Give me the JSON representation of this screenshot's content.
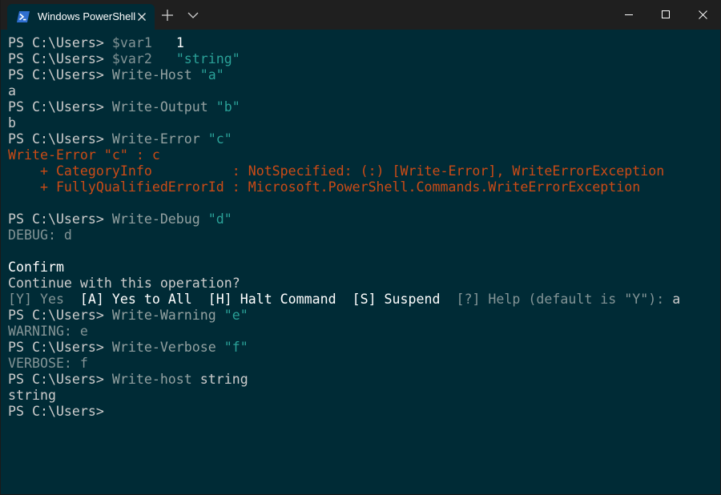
{
  "window": {
    "tab_title": "Windows PowerShell"
  },
  "terminal": {
    "lines": [
      [
        {
          "t": "PS C:\\Users> ",
          "c": "prompt"
        },
        {
          "t": "$var1",
          "c": "var"
        },
        {
          "t": "   ",
          "c": "out"
        },
        {
          "t": "1",
          "c": "num"
        }
      ],
      [
        {
          "t": "PS C:\\Users> ",
          "c": "prompt"
        },
        {
          "t": "$var2",
          "c": "var"
        },
        {
          "t": "   ",
          "c": "out"
        },
        {
          "t": "\"string\"",
          "c": "str"
        }
      ],
      [
        {
          "t": "PS C:\\Users> ",
          "c": "prompt"
        },
        {
          "t": "Write-Host",
          "c": "cmd"
        },
        {
          "t": " ",
          "c": "out"
        },
        {
          "t": "\"a\"",
          "c": "str"
        }
      ],
      [
        {
          "t": "a",
          "c": "out"
        }
      ],
      [
        {
          "t": "PS C:\\Users> ",
          "c": "prompt"
        },
        {
          "t": "Write-Output",
          "c": "cmd"
        },
        {
          "t": " ",
          "c": "out"
        },
        {
          "t": "\"b\"",
          "c": "str"
        }
      ],
      [
        {
          "t": "b",
          "c": "out"
        }
      ],
      [
        {
          "t": "PS C:\\Users> ",
          "c": "prompt"
        },
        {
          "t": "Write-Error",
          "c": "cmd"
        },
        {
          "t": " ",
          "c": "out"
        },
        {
          "t": "\"c\"",
          "c": "str"
        }
      ],
      [
        {
          "t": "Write-Error \"c\" : c",
          "c": "err"
        }
      ],
      [
        {
          "t": "    + CategoryInfo          : NotSpecified: (:) [Write-Error], WriteErrorException",
          "c": "err"
        }
      ],
      [
        {
          "t": "    + FullyQualifiedErrorId : Microsoft.PowerShell.Commands.WriteErrorException",
          "c": "err"
        }
      ],
      [],
      [
        {
          "t": "PS C:\\Users> ",
          "c": "prompt"
        },
        {
          "t": "Write-Debug",
          "c": "cmd"
        },
        {
          "t": " ",
          "c": "out"
        },
        {
          "t": "\"d\"",
          "c": "str"
        }
      ],
      [
        {
          "t": "DEBUG: d",
          "c": "dim"
        }
      ],
      [],
      [
        {
          "t": "Confirm",
          "c": "white"
        }
      ],
      [
        {
          "t": "Continue with this operation?",
          "c": "out"
        }
      ],
      [
        {
          "t": "[Y] Yes  ",
          "c": "dim"
        },
        {
          "t": "[A] Yes to All  [H] Halt Command  [S] Suspend  ",
          "c": "white"
        },
        {
          "t": "[?] Help (default is \"Y\"): ",
          "c": "dim"
        },
        {
          "t": "a",
          "c": "out"
        }
      ],
      [
        {
          "t": "PS C:\\Users> ",
          "c": "prompt"
        },
        {
          "t": "Write-Warning",
          "c": "cmd"
        },
        {
          "t": " ",
          "c": "out"
        },
        {
          "t": "\"e\"",
          "c": "str"
        }
      ],
      [
        {
          "t": "WARNING: e",
          "c": "dim"
        }
      ],
      [
        {
          "t": "PS C:\\Users> ",
          "c": "prompt"
        },
        {
          "t": "Write-Verbose",
          "c": "cmd"
        },
        {
          "t": " ",
          "c": "out"
        },
        {
          "t": "\"f\"",
          "c": "str"
        }
      ],
      [
        {
          "t": "VERBOSE: f",
          "c": "dim"
        }
      ],
      [
        {
          "t": "PS C:\\Users> ",
          "c": "prompt"
        },
        {
          "t": "Write-host",
          "c": "cmd"
        },
        {
          "t": " string",
          "c": "out"
        }
      ],
      [
        {
          "t": "string",
          "c": "out"
        }
      ],
      [
        {
          "t": "PS C:\\Users>",
          "c": "prompt"
        }
      ]
    ]
  },
  "icons": {
    "tab": "powershell-icon",
    "tab_close": "close-icon",
    "new_tab": "plus-icon",
    "dropdown": "chevron-down-icon",
    "minimize": "minimize-icon",
    "maximize": "maximize-icon",
    "close": "close-icon"
  },
  "colors": {
    "background": "#002b36",
    "titlebar": "#1f1f1f",
    "string": "#2aa198",
    "error": "#cb4b16"
  }
}
